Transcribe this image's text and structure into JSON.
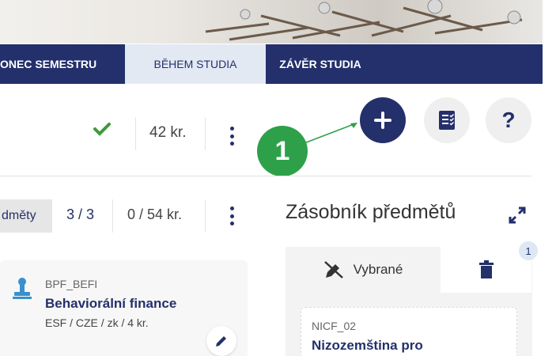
{
  "nav": {
    "tabs": [
      {
        "label": "ONEC SEMESTRU"
      },
      {
        "label": "BĚHEM STUDIA"
      },
      {
        "label": "ZÁVĚR STUDIA"
      }
    ]
  },
  "header": {
    "credits": "42 kr."
  },
  "toolbar": {
    "add_label": "+",
    "help_label": "?"
  },
  "annotation": {
    "step": "1"
  },
  "subjects": {
    "filter_label": "dměty",
    "count": "3 / 3",
    "credits": "0 / 54 kr."
  },
  "course_card": {
    "code": "BPF_BEFI",
    "title": "Behaviorální finance",
    "meta": "ESF / CZE / zk / 4 kr."
  },
  "stack": {
    "title": "Zásobník předmětů",
    "tab_selected_label": "Vybrané",
    "badge_count": "1",
    "item": {
      "code": "NICF_02",
      "title": "Nizozemština pro"
    }
  },
  "colors": {
    "navy": "#24306b",
    "green": "#2fa04a",
    "check": "#3f9a3a",
    "light_tab": "#e3e9f3"
  },
  "icons": [
    "check-icon",
    "kebab-menu-icon",
    "plus-icon",
    "checklist-icon",
    "help-icon",
    "expand-icon",
    "stamp-icon",
    "edit-pencil-icon",
    "pen-off-icon",
    "trash-icon"
  ]
}
